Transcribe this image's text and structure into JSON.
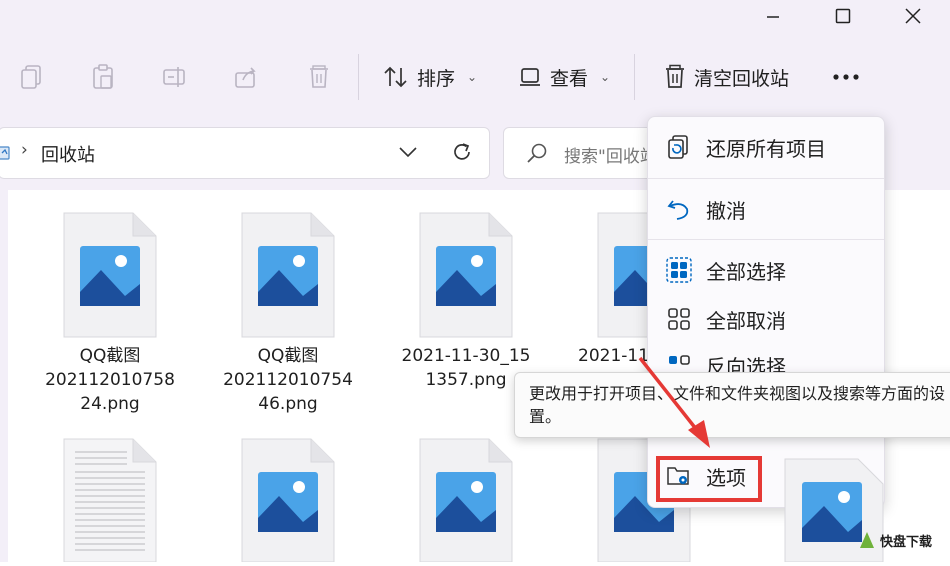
{
  "window": {
    "minimize_icon": "minimize-icon",
    "maximize_icon": "maximize-icon",
    "close_icon": "close-icon"
  },
  "toolbar": {
    "sort_label": "排序",
    "view_label": "查看",
    "empty_bin_label": "清空回收站"
  },
  "address": {
    "path": "回收站"
  },
  "search": {
    "placeholder": "搜索\"回收站\""
  },
  "files": [
    {
      "line1": "QQ截图",
      "line2": "202112010758",
      "line3": "24.png"
    },
    {
      "line1": "QQ截图",
      "line2": "202112010754",
      "line3": "46.png"
    },
    {
      "line1": "2021-11-30_15",
      "line2": "1357.png",
      "line3": ""
    },
    {
      "line1": "2021-11",
      "line2": "",
      "line3": ""
    }
  ],
  "menu": {
    "restore_all": "还原所有项目",
    "undo": "撤消",
    "select_all": "全部选择",
    "select_none": "全部取消",
    "invert": "反向选择",
    "options": "选项"
  },
  "tooltip": {
    "text": "更改用于打开项目、文件和文件夹视图以及搜索等方面的设置。"
  },
  "watermark": {
    "text": "快盘下载"
  },
  "colors": {
    "accent": "#0067c0",
    "highlight": "#e53935",
    "image_icon_sky": "#4aa3e8",
    "image_icon_mountain": "#1c4f9c"
  }
}
